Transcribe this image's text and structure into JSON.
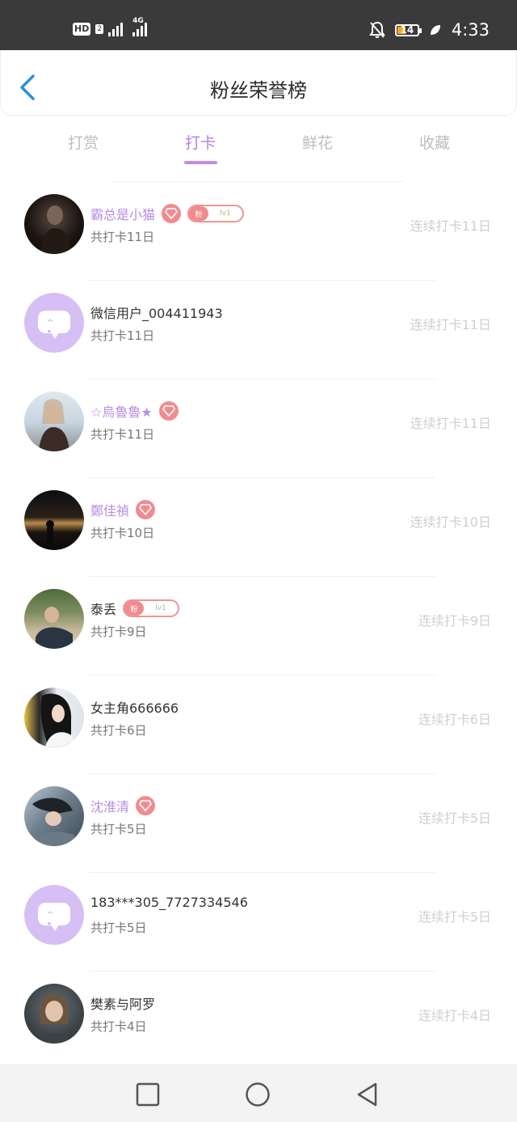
{
  "status_bar": {
    "hd_label": "HD",
    "hd_sub": "2",
    "net_label": "4G",
    "battery": "14",
    "time": "4:33",
    "colors": {
      "background": "#3a3a3a",
      "battery_fill": "#f6a623"
    }
  },
  "header": {
    "title": "粉丝荣誉榜",
    "back_icon": "chevron-left-icon"
  },
  "tabs": [
    {
      "label": "打赏",
      "active": false
    },
    {
      "label": "打卡",
      "active": true
    },
    {
      "label": "鲜花",
      "active": false
    },
    {
      "label": "收藏",
      "active": false
    }
  ],
  "list": [
    {
      "name": "霸总是小猫",
      "vip": true,
      "gem": true,
      "fan_badge": {
        "label": "粉",
        "level": "lv1"
      },
      "total": "共打卡11日",
      "streak": "连续打卡11日",
      "avatar": "photo"
    },
    {
      "name": "微信用户_004411943",
      "vip": false,
      "gem": false,
      "fan_badge": null,
      "total": "共打卡11日",
      "streak": "连续打卡11日",
      "avatar": "default"
    },
    {
      "name": "☆烏魯魯★",
      "vip": true,
      "gem": true,
      "fan_badge": null,
      "total": "共打卡11日",
      "streak": "连续打卡11日",
      "avatar": "photo"
    },
    {
      "name": "鄭佳禎",
      "vip": true,
      "gem": true,
      "fan_badge": null,
      "total": "共打卡10日",
      "streak": "连续打卡10日",
      "avatar": "photo"
    },
    {
      "name": "泰丢",
      "vip": false,
      "gem": false,
      "fan_badge": {
        "label": "粉",
        "level": "lv1"
      },
      "total": "共打卡9日",
      "streak": "连续打卡9日",
      "avatar": "photo"
    },
    {
      "name": "女主角666666",
      "vip": false,
      "gem": false,
      "fan_badge": null,
      "total": "共打卡6日",
      "streak": "连续打卡6日",
      "avatar": "photo"
    },
    {
      "name": "沈淮清",
      "vip": true,
      "gem": true,
      "fan_badge": null,
      "total": "共打卡5日",
      "streak": "连续打卡5日",
      "avatar": "photo"
    },
    {
      "name": "183***305_7727334546",
      "vip": false,
      "gem": false,
      "fan_badge": null,
      "total": "共打卡5日",
      "streak": "连续打卡5日",
      "avatar": "default"
    },
    {
      "name": "樊素与阿罗",
      "vip": false,
      "gem": false,
      "fan_badge": null,
      "total": "共打卡4日",
      "streak": "连续打卡4日",
      "avatar": "photo"
    }
  ],
  "nav_bar": {
    "icons": [
      "square-icon",
      "circle-icon",
      "triangle-back-icon"
    ]
  },
  "colors": {
    "accent": "#b77fe0",
    "gem": "#f08c8f",
    "default_avatar": "#d6bff4"
  }
}
